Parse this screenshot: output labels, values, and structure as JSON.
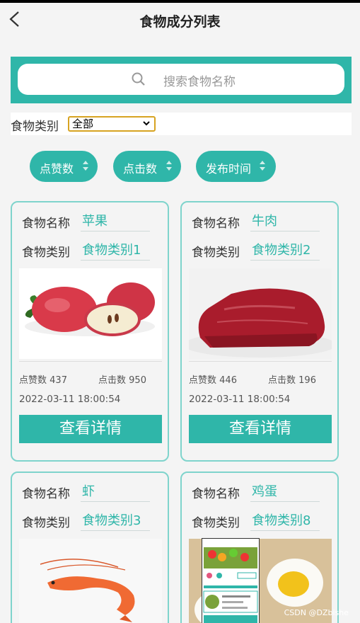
{
  "nav": {
    "title": "食物成分列表"
  },
  "search": {
    "placeholder": "搜索食物名称"
  },
  "filter": {
    "label": "食物类别",
    "selected": "全部"
  },
  "sort_buttons": [
    "点赞数",
    "点击数",
    "发布时间"
  ],
  "labels": {
    "name": "食物名称",
    "category": "食物类别",
    "likes": "点赞数",
    "clicks": "点击数",
    "detail": "查看详情"
  },
  "cards": [
    {
      "name": "苹果",
      "category": "食物类别1",
      "likes": "437",
      "clicks": "950",
      "time": "2022-03-11 18:00:54"
    },
    {
      "name": "牛肉",
      "category": "食物类别2",
      "likes": "446",
      "clicks": "196",
      "time": "2022-03-11 18:00:54"
    },
    {
      "name": "虾",
      "category": "食物类别3"
    },
    {
      "name": "鸡蛋",
      "category": "食物类别8"
    }
  ],
  "watermark": "CSDN @DZbishe",
  "colors": {
    "accent": "#2fb6a9",
    "border": "#7fd4cc",
    "select_border": "#d7a321"
  }
}
